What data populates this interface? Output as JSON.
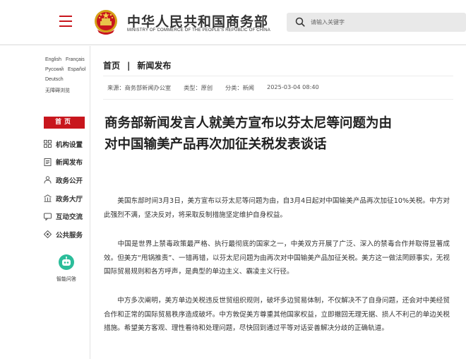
{
  "header": {
    "site_name_cn": "中华人民共和国商务部",
    "site_name_en": "MINISTRY OF COMMERCE OF THE PEOPLE'S REPUBLIC OF CHINA",
    "search_placeholder": "请输入关键字",
    "brand_color": "#c8161d",
    "emblem_icon": "national-emblem-icon",
    "menu_icon": "hamburger-menu-icon",
    "search_icon": "search-icon"
  },
  "sidebar": {
    "languages": [
      "English",
      "Français",
      "Русский",
      "Español",
      "Deutsch",
      "无障碍浏览"
    ],
    "home_label": "首页",
    "nav_items": [
      {
        "label": "机构设置",
        "icon": "org-grid-icon"
      },
      {
        "label": "新闻发布",
        "icon": "news-document-icon"
      },
      {
        "label": "政务公开",
        "icon": "open-people-icon"
      },
      {
        "label": "政务大厅",
        "icon": "hall-icon"
      },
      {
        "label": "互动交流",
        "icon": "chat-icon"
      },
      {
        "label": "公共服务",
        "icon": "service-icon"
      }
    ],
    "assistant_label": "智能问答",
    "assistant_icon": "robot-icon",
    "assistant_color": "#2bbd9a"
  },
  "breadcrumb": {
    "home": "首页",
    "separator": "|",
    "current": "新闻发布"
  },
  "meta": {
    "source": "来源：商务部新闻办公室",
    "type": "类型：原创",
    "category": "分类：新闻",
    "datetime": "2025-03-04 08:40"
  },
  "article": {
    "title_line1": "商务部新闻发言人就美方宣布以芬太尼等问题为由",
    "title_line2": "对中国输美产品再次加征关税发表谈话",
    "paragraphs": [
      "美国东部时间3月3日，美方宣布以芬太尼等问题为由，自3月4日起对中国输美产品再次加征10%关税。中方对此强烈不满，坚决反对，将采取反制措施坚定维护自身权益。",
      "中国是世界上禁毒政策最严格、执行最彻底的国家之一，中美双方开展了广泛、深入的禁毒合作并取得显著成效。但美方“甩锅推责”、一错再错，以芬太尼问题为由再次对中国输美产品加征关税。美方这一做法罔顾事实，无视国际贸易规则和各方呼声，是典型的单边主义、霸凌主义行径。",
      "中方多次阐明，美方单边关税违反世贸组织规则，破坏多边贸易体制，不仅解决不了自身问题，还会对中美经贸合作和正常的国际贸易秩序造成破坏。中方敦促美方尊重其他国家权益，立即撤回无理无据、损人不利己的单边关税措施。希望美方客观、理性看待和处理问题，尽快回到通过平等对话妥善解决分歧的正确轨道。"
    ]
  }
}
